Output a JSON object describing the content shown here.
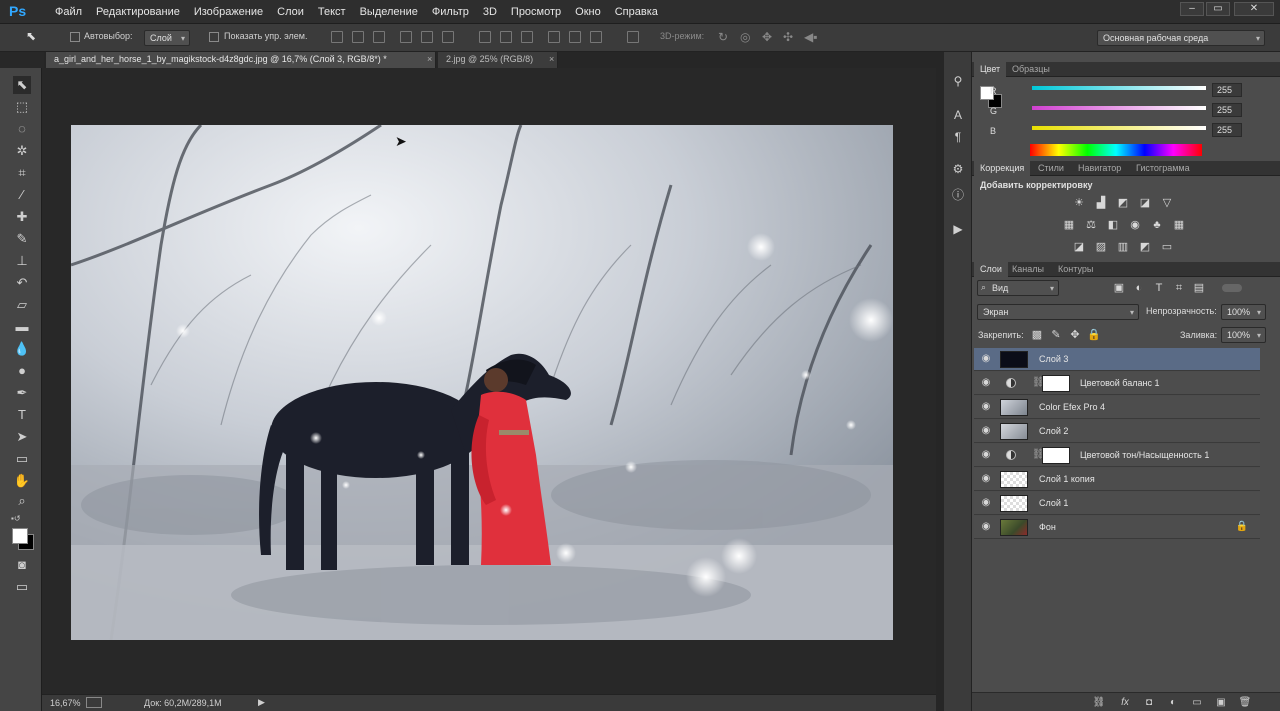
{
  "app": {
    "logo": "Ps"
  },
  "menu": [
    "Файл",
    "Редактирование",
    "Изображение",
    "Слои",
    "Текст",
    "Выделение",
    "Фильтр",
    "3D",
    "Просмотр",
    "Окно",
    "Справка"
  ],
  "window_controls": [
    "–",
    "▭",
    "✕"
  ],
  "options": {
    "autoselect_label": "Автовыбор:",
    "autoselect_value": "Слой",
    "show_transform_label": "Показать упр. элем.",
    "mode_3d_label": "3D-режим:",
    "workspace_value": "Основная рабочая среда"
  },
  "doc_tabs": [
    {
      "label": "a_girl_and_her_horse_1_by_magikstock-d4z8gdc.jpg @ 16,7% (Слой 3, RGB/8*) *",
      "close": "×"
    },
    {
      "label": "2.jpg @ 25% (RGB/8)",
      "close": "×"
    }
  ],
  "status": {
    "zoom": "16,67%",
    "doc": "Док: 60,2M/289,1M",
    "arrow": "▶"
  },
  "color_panel": {
    "tabs": [
      "Цвет",
      "Образцы"
    ],
    "channels": [
      {
        "label": "R",
        "value": "255",
        "color": "#00c8d8"
      },
      {
        "label": "G",
        "value": "255",
        "color": "#d040d0"
      },
      {
        "label": "B",
        "value": "255",
        "color": "#e8e000"
      }
    ]
  },
  "adjust_panel": {
    "tabs": [
      "Коррекция",
      "Стили",
      "Навигатор",
      "Гистограмма"
    ],
    "title": "Добавить корректировку"
  },
  "layers_panel": {
    "tabs": [
      "Слои",
      "Каналы",
      "Контуры"
    ],
    "filter_value": "Вид",
    "blend_mode": "Экран",
    "opacity_label": "Непрозрачность:",
    "opacity_value": "100%",
    "lock_label": "Закрепить:",
    "fill_label": "Заливка:",
    "fill_value": "100%",
    "layers": [
      {
        "name": "Слой 3",
        "type": "pixel",
        "selected": true
      },
      {
        "name": "Цветовой баланс 1",
        "type": "adjustment"
      },
      {
        "name": "Color Efex Pro 4",
        "type": "pixel"
      },
      {
        "name": "Слой 2",
        "type": "pixel"
      },
      {
        "name": "Цветовой тон/Насыщенность 1",
        "type": "adjustment"
      },
      {
        "name": "Слой 1 копия",
        "type": "pixel"
      },
      {
        "name": "Слой 1",
        "type": "pixel"
      },
      {
        "name": "Фон",
        "type": "background",
        "locked": true
      }
    ]
  },
  "colors": {
    "accent": "#31a8ff",
    "selected_layer": "#5a6b86",
    "dress": "#e0303c"
  }
}
